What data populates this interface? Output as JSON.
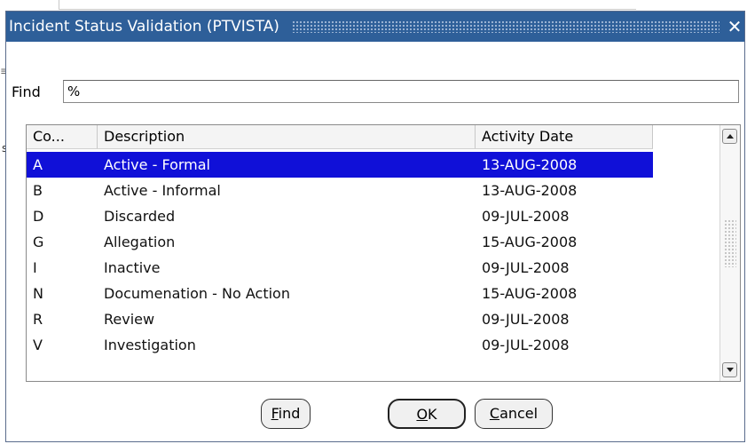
{
  "dialog": {
    "title": "Incident Status Validation (PTVISTA)",
    "close_glyph": "✕"
  },
  "find": {
    "label": "Find",
    "value": "%"
  },
  "grid": {
    "columns": [
      "Co...",
      "Description",
      "Activity Date"
    ],
    "rows": [
      {
        "code": "A",
        "description": "Active - Formal",
        "date": "13-AUG-2008",
        "selected": true
      },
      {
        "code": "B",
        "description": "Active - Informal",
        "date": "13-AUG-2008",
        "selected": false
      },
      {
        "code": "D",
        "description": "Discarded",
        "date": "09-JUL-2008",
        "selected": false
      },
      {
        "code": "G",
        "description": "Allegation",
        "date": "15-AUG-2008",
        "selected": false
      },
      {
        "code": "I",
        "description": "Inactive",
        "date": "09-JUL-2008",
        "selected": false
      },
      {
        "code": "N",
        "description": "Documenation - No Action",
        "date": "15-AUG-2008",
        "selected": false
      },
      {
        "code": "R",
        "description": "Review",
        "date": "09-JUL-2008",
        "selected": false
      },
      {
        "code": "V",
        "description": "Investigation",
        "date": "09-JUL-2008",
        "selected": false
      }
    ]
  },
  "buttons": {
    "find_mnemonic": "F",
    "find_rest": "ind",
    "ok_mnemonic": "O",
    "ok_rest": "K",
    "cancel_mnemonic": "C",
    "cancel_rest": "ancel"
  },
  "colors": {
    "titlebar": "#2e5f99",
    "selection": "#1010d8"
  }
}
